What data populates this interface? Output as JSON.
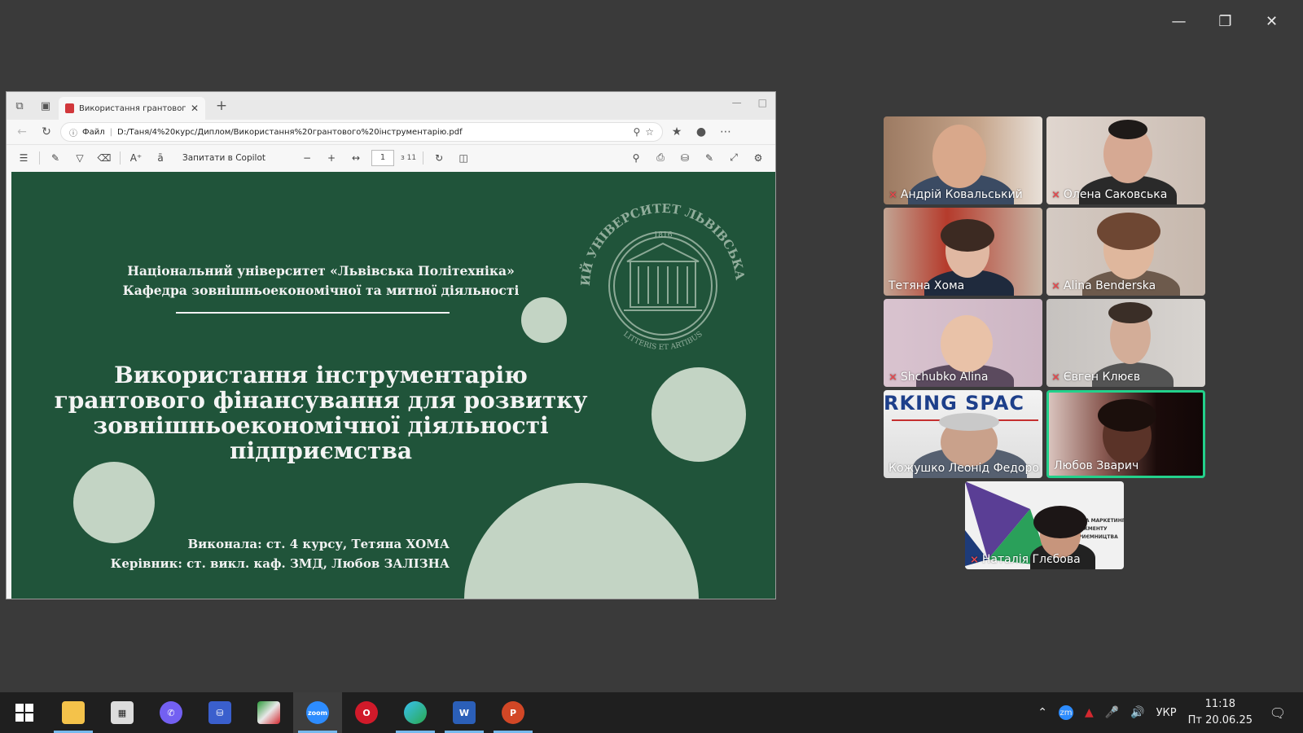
{
  "window": {
    "minimize_icon": "minimize-icon",
    "restore_icon": "restore-icon",
    "close_icon": "close-icon"
  },
  "browser": {
    "tab_title": "Використання грантового інстру",
    "address_prefix": "Файл",
    "url": "D:/Таня/4%20курс/Диплом/Використання%20грантового%20інструментарію.pdf",
    "pdf_toolbar": {
      "copilot_label": "Запитати в Copilot",
      "zoom_out": "−",
      "zoom_in": "+",
      "page_current": "1",
      "page_total": "з 11"
    }
  },
  "slide": {
    "university": "Національний університет «Львівська Політехніка»",
    "department": "Кафедра зовнішньоекономічної та митної діяльності",
    "title_lines": [
      "Використання інструментарію",
      "грантового фінансування для розвитку",
      "зовнішньоекономічної діяльності",
      "підприємства"
    ],
    "author": "Виконала: ст. 4 курсу, Тетяна ХОМА",
    "supervisor": "Керівник: ст. викл. каф. ЗМД, Любов ЗАЛІЗНА",
    "seal_text": "НАЦІОНАЛЬНИЙ УНІВЕРСИТЕТ ЛЬВІВСЬКА ПОЛІТЕХНІКА",
    "seal_year": "1816",
    "seal_motto": "LITTERIS ET ARTIBUS"
  },
  "participants": [
    {
      "name": "Андрій Ковальський",
      "muted": true
    },
    {
      "name": "Олена Саковська",
      "muted": true
    },
    {
      "name": "Тетяна Хома",
      "muted": false
    },
    {
      "name": "Alina Benderska",
      "muted": true
    },
    {
      "name": "Shchubko Alina",
      "muted": true
    },
    {
      "name": "Євген Клюєв",
      "muted": true
    },
    {
      "name": "Кожушко Леонід Федоро...",
      "muted": false
    },
    {
      "name": "Любов Зварич",
      "muted": false,
      "speaking": true
    },
    {
      "name": "Наталія Глєбова",
      "muted": true
    }
  ],
  "tile_backgrounds": {
    "coworking_text": "RKING SPAC",
    "dept_text_lines": [
      "ЕДРА МАРКЕТИНГ",
      "ЕДЖМЕНТУ",
      "ПРИЄМНИЦТВА"
    ]
  },
  "taskbar": {
    "apps": [
      "windows-start",
      "file-explorer",
      "calculator",
      "viber",
      "save-app",
      "acrobat",
      "zoom",
      "opera",
      "edge",
      "word",
      "powerpoint"
    ],
    "zoom_label": "zoom",
    "word_label": "W",
    "ppt_label": "P",
    "language": "УКР",
    "time": "11:18",
    "date": "Пт 20.06.25",
    "tray_zoom_label": "zm"
  },
  "colors": {
    "slide_bg": "#20543a",
    "circle": "#c3d4c4",
    "active_border": "#23d18b",
    "mute": "#e5484d"
  }
}
